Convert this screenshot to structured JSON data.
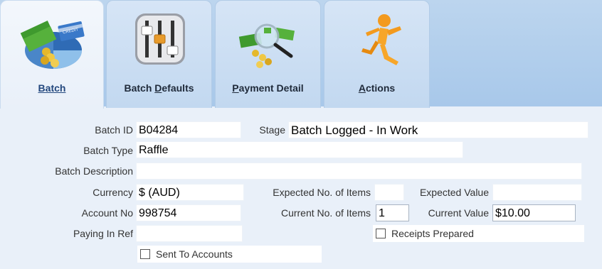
{
  "tabs": [
    {
      "label": "Batch",
      "icon": "money-card-icon",
      "active": true
    },
    {
      "label": "Batch Defaults",
      "icon": "sliders-icon",
      "active": false
    },
    {
      "label": "Payment Detail",
      "icon": "magnifier-money-icon",
      "active": false
    },
    {
      "label": "Actions",
      "icon": "running-man-icon",
      "active": false
    }
  ],
  "tab_labels": {
    "batch": {
      "pre": "",
      "u": "B",
      "post": "atch"
    },
    "defaults": {
      "pre": "Batch ",
      "u": "D",
      "post": "efaults"
    },
    "payment": {
      "pre": "",
      "u": "P",
      "post": "ayment Detail"
    },
    "actions": {
      "pre": "",
      "u": "A",
      "post": "ctions"
    }
  },
  "card_text": "CREDIT",
  "form": {
    "batch_id_label": "Batch ID",
    "batch_id": "B04284",
    "stage_label": "Stage",
    "stage": "Batch Logged - In Work",
    "batch_type_label": "Batch Type",
    "batch_type": "Raffle",
    "batch_desc_label": "Batch Description",
    "batch_desc": "",
    "currency_label": "Currency",
    "currency": "$ (AUD)",
    "expected_items_label": "Expected No. of Items",
    "expected_items": "",
    "expected_value_label": "Expected Value",
    "expected_value": "",
    "account_no_label": "Account No",
    "account_no": "998754",
    "current_items_label": "Current No. of Items",
    "current_items": "1",
    "current_value_label": "Current Value",
    "current_value": "$10.00",
    "paying_in_ref_label": "Paying In Ref",
    "paying_in_ref": "",
    "receipts_prepared_label": "Receipts Prepared",
    "sent_to_accounts_label": "Sent To Accounts"
  }
}
